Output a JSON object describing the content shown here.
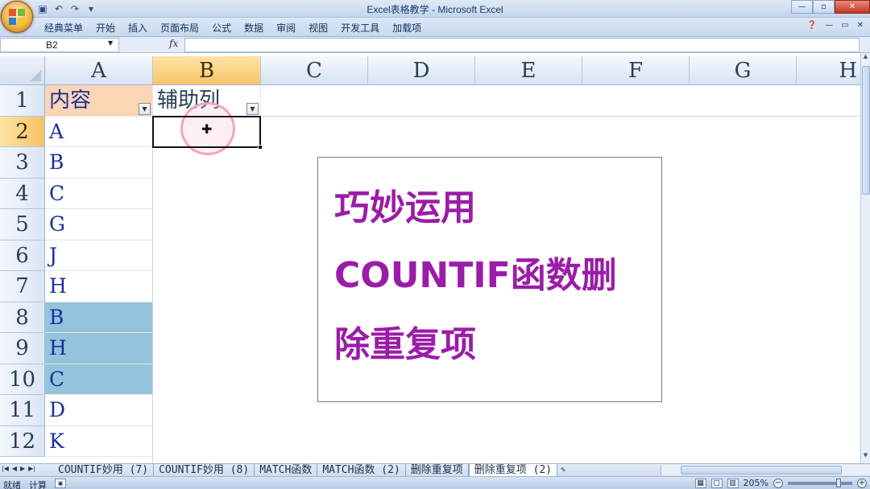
{
  "window": {
    "title": "Excel表格教学 - Microsoft Excel",
    "controls": {
      "minimize": "—",
      "maximize": "▫",
      "close": "✕"
    }
  },
  "menu": {
    "items": [
      "经典菜单",
      "开始",
      "插入",
      "页面布局",
      "公式",
      "数据",
      "审阅",
      "视图",
      "开发工具",
      "加载项"
    ]
  },
  "formula_bar": {
    "name_box": "B2",
    "fx_label": "fx",
    "formula": ""
  },
  "grid": {
    "columns": [
      "A",
      "B",
      "C",
      "D",
      "E",
      "F",
      "G",
      "H"
    ],
    "selected_column": "B",
    "rows": [
      "1",
      "2",
      "3",
      "4",
      "5",
      "6",
      "7",
      "8",
      "9",
      "10",
      "11",
      "12"
    ],
    "selected_row": "2",
    "header_row": {
      "A": "内容",
      "B": "辅助列"
    },
    "column_a_values": [
      "A",
      "B",
      "C",
      "G",
      "J",
      "H",
      "B",
      "H",
      "C",
      "D",
      "K"
    ],
    "highlight_color": "#93c4db",
    "header_fill": "#fcd5b4"
  },
  "textbox": {
    "lines": [
      "巧妙运用",
      "COUNTIF函数删",
      "除重复项"
    ],
    "color": "#9b1ca8"
  },
  "sheet_tabs": {
    "tabs": [
      "COUNTIF妙用 (7)",
      "COUNTIF妙用 (8)",
      "MATCH函数",
      "MATCH函数 (2)",
      "删除重复项",
      "删除重复项 (2)"
    ],
    "active": "删除重复项 (2)"
  },
  "status": {
    "mode": "就绪",
    "calc": "计算",
    "zoom": "205%"
  }
}
